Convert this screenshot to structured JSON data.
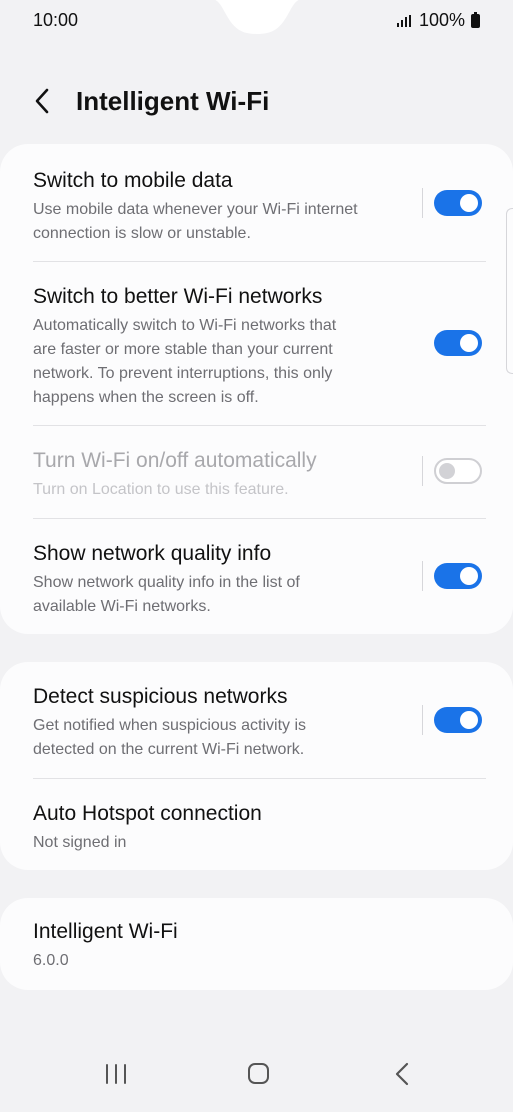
{
  "status": {
    "time": "10:00",
    "battery": "100%"
  },
  "header": {
    "title": "Intelligent Wi-Fi"
  },
  "section1": {
    "mobile_data": {
      "title": "Switch to mobile data",
      "subtitle_l1": "Use mobile data whenever your Wi-Fi internet",
      "subtitle_l2": "connection is slow or unstable.",
      "state": "on"
    },
    "better_wifi": {
      "title": "Switch to better Wi-Fi networks",
      "subtitle_l1": "Automatically switch to Wi-Fi networks that",
      "subtitle_l2": "are faster or more stable than your current",
      "subtitle_l3": "network. To prevent interruptions, this only",
      "subtitle_l4": "happens when the screen is off.",
      "state": "on"
    },
    "auto_onoff": {
      "title": "Turn Wi-Fi on/off automatically",
      "subtitle_l1": "Turn on Location to use this feature.",
      "state": "off"
    },
    "quality_info": {
      "title": "Show network quality info",
      "subtitle_l1": "Show network quality info in the list of",
      "subtitle_l2": "available Wi-Fi networks.",
      "state": "on"
    }
  },
  "section2": {
    "suspicious": {
      "title": "Detect suspicious networks",
      "subtitle_l1": "Get notified when suspicious activity is",
      "subtitle_l2": "detected on the current Wi-Fi network.",
      "state": "on"
    },
    "hotspot": {
      "title": "Auto Hotspot connection",
      "subtitle_l1": "Not signed in"
    }
  },
  "section3": {
    "about": {
      "title": "Intelligent Wi-Fi",
      "subtitle_l1": "6.0.0"
    }
  },
  "colors": {
    "accent": "#1a73e8",
    "background": "#f2f2f4",
    "card": "#fcfcfd"
  },
  "icons": {
    "back": "chevron-left-icon",
    "recents": "recents-icon",
    "home": "home-icon",
    "nav_back": "nav-back-icon"
  }
}
